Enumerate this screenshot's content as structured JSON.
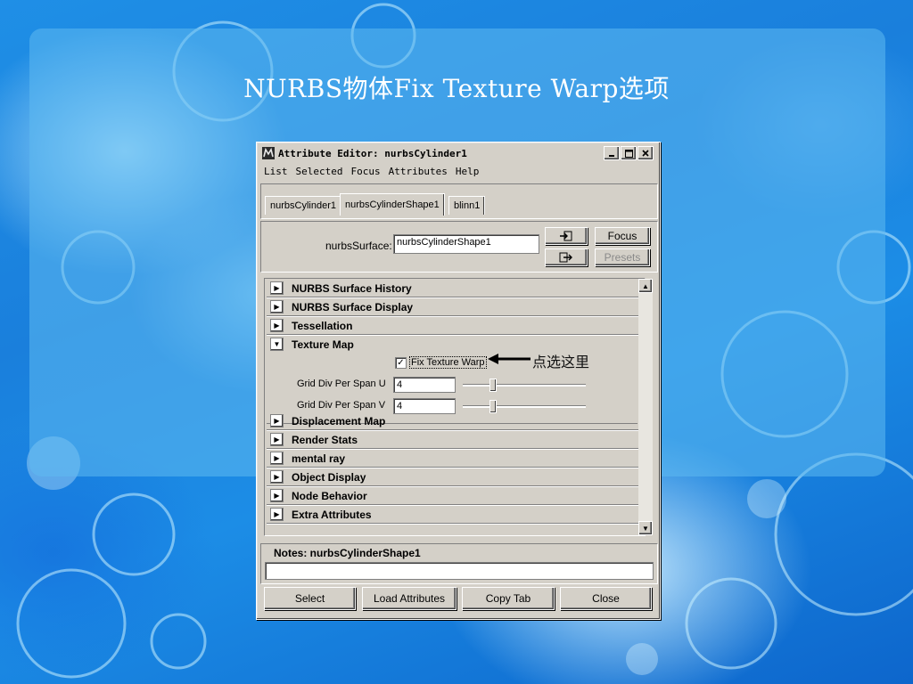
{
  "slide": {
    "title": "NURBS物体Fix Texture Warp选项",
    "callout": "点选这里"
  },
  "window": {
    "title": "Attribute Editor: nurbsCylinder1",
    "icon": "maya-icon",
    "controls": [
      "minimize-icon",
      "maximize-icon",
      "close-icon"
    ]
  },
  "menu": [
    "List",
    "Selected",
    "Focus",
    "Attributes",
    "Help"
  ],
  "tabs": [
    {
      "label": "nurbsCylinder1",
      "active": false
    },
    {
      "label": "nurbsCylinderShape1",
      "active": true
    },
    {
      "label": "blinn1",
      "active": false
    }
  ],
  "node": {
    "label": "nurbsSurface:",
    "value": "nurbsCylinderShape1",
    "focus_label": "Focus",
    "presets_label": "Presets"
  },
  "sections": [
    {
      "label": "NURBS Surface History",
      "expanded": false
    },
    {
      "label": "NURBS Surface Display",
      "expanded": false
    },
    {
      "label": "Tessellation",
      "expanded": false
    },
    {
      "label": "Texture Map",
      "expanded": true
    },
    {
      "label": "Displacement Map",
      "expanded": false
    },
    {
      "label": "Render Stats",
      "expanded": false
    },
    {
      "label": "mental ray",
      "expanded": false
    },
    {
      "label": "Object Display",
      "expanded": false
    },
    {
      "label": "Node Behavior",
      "expanded": false
    },
    {
      "label": "Extra Attributes",
      "expanded": false
    }
  ],
  "texture_map": {
    "fix_texture_warp": {
      "label": "Fix Texture Warp",
      "checked": true
    },
    "grid_u": {
      "label": "Grid Div Per Span U",
      "value": "4"
    },
    "grid_v": {
      "label": "Grid Div Per Span V",
      "value": "4"
    }
  },
  "notes": {
    "label": "Notes: nurbsCylinderShape1",
    "value": ""
  },
  "bottom_buttons": {
    "select": "Select",
    "load": "Load Attributes",
    "copy": "Copy Tab",
    "close": "Close"
  }
}
